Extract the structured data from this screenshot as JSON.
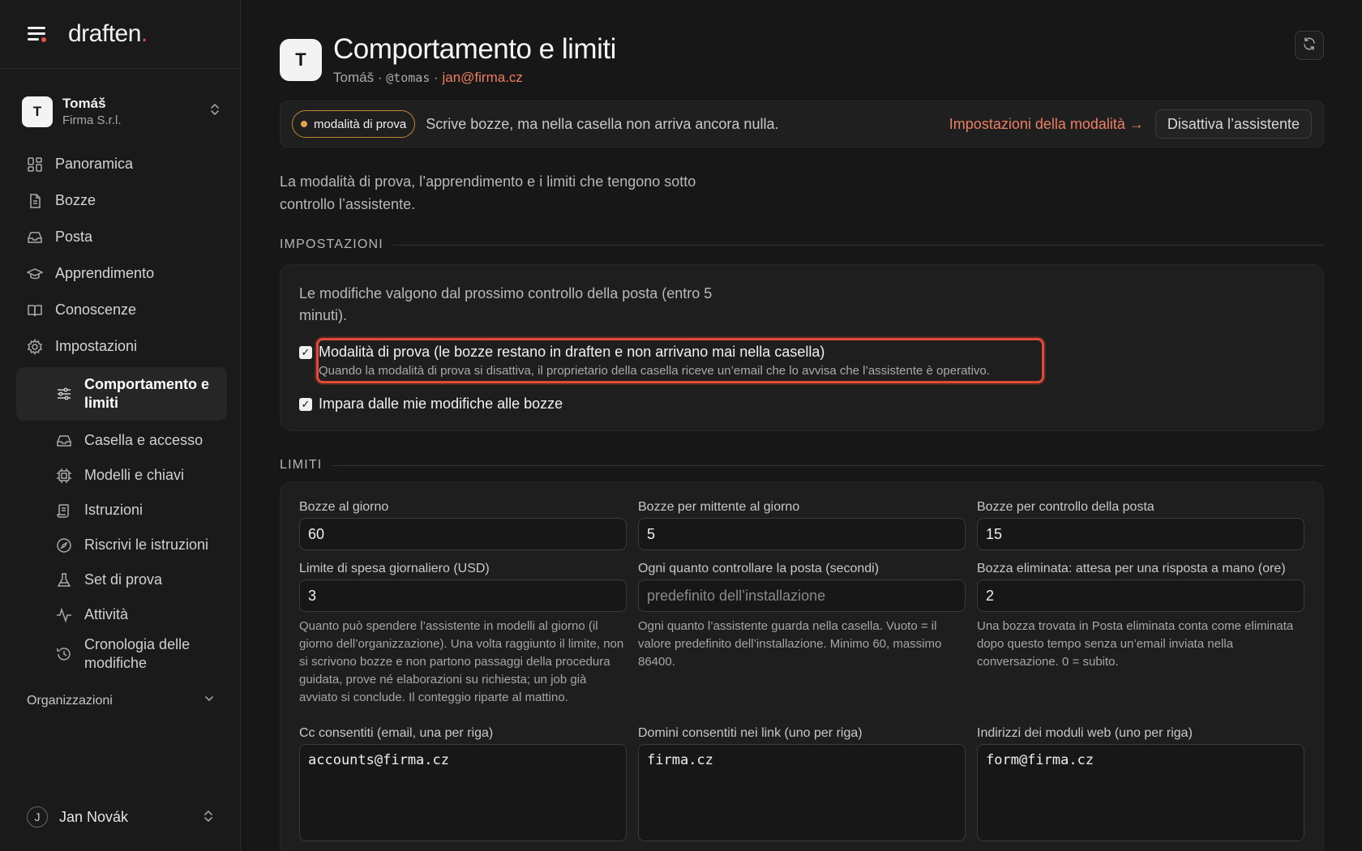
{
  "app": {
    "logo_text": "draften",
    "logo_dot": "."
  },
  "account": {
    "initial": "T",
    "name": "Tomáš",
    "org": "Firma S.r.l."
  },
  "nav": {
    "items": [
      {
        "label": "Panoramica",
        "icon": "grid-icon"
      },
      {
        "label": "Bozze",
        "icon": "document-icon"
      },
      {
        "label": "Posta",
        "icon": "inbox-icon"
      },
      {
        "label": "Apprendimento",
        "icon": "graduation-cap-icon"
      },
      {
        "label": "Conoscenze",
        "icon": "book-icon"
      },
      {
        "label": "Impostazioni",
        "icon": "gear-icon"
      }
    ],
    "sub_items": [
      {
        "label": "Comportamento e limiti",
        "icon": "sliders-icon",
        "active": true
      },
      {
        "label": "Casella e accesso",
        "icon": "inbox-icon"
      },
      {
        "label": "Modelli e chiavi",
        "icon": "chip-icon"
      },
      {
        "label": "Istruzioni",
        "icon": "script-icon"
      },
      {
        "label": "Riscrivi le istruzioni",
        "icon": "compass-icon"
      },
      {
        "label": "Set di prova",
        "icon": "flask-icon"
      },
      {
        "label": "Attività",
        "icon": "activity-icon"
      },
      {
        "label": "Cronologia delle modifiche",
        "icon": "history-icon"
      }
    ],
    "orgs_label": "Organizzazioni"
  },
  "user": {
    "initial": "J",
    "name": "Jan Novák"
  },
  "header": {
    "initial": "T",
    "title": "Comportamento e limiti",
    "name": "Tomáš",
    "sep1": " · ",
    "handle": "@tomas",
    "sep2": " · ",
    "email": "jan@firma.cz"
  },
  "banner": {
    "pill": "modalità di prova",
    "text": "Scrive bozze, ma nella casella non arriva ancora nulla.",
    "link": "Impostazioni della modalità →",
    "button": "Disattiva l’assistente"
  },
  "intro": "La modalità di prova, l’apprendimento e i limiti che tengono sotto controllo l’assistente.",
  "settings": {
    "heading": "IMPOSTAZIONI",
    "note": "Le modifiche valgono dal prossimo controllo della posta (entro 5 minuti).",
    "test_mode": {
      "checked": true,
      "label": "Modalità di prova (le bozze restano in draften e non arrivano mai nella casella)",
      "desc": "Quando la modalità di prova si disattiva, il proprietario della casella riceve un’email che lo avvisa che l’assistente è operativo."
    },
    "learn": {
      "checked": true,
      "label": "Impara dalle mie modifiche alle bozze"
    }
  },
  "limits": {
    "heading": "LIMITI",
    "drafts_per_day": {
      "label": "Bozze al giorno",
      "value": "60"
    },
    "drafts_per_sender": {
      "label": "Bozze per mittente al giorno",
      "value": "5"
    },
    "drafts_per_check": {
      "label": "Bozze per controllo della posta",
      "value": "15"
    },
    "spend_limit": {
      "label": "Limite di spesa giornaliero (USD)",
      "value": "3",
      "help": "Quanto può spendere l’assistente in modelli al giorno (il giorno dell’organizzazione). Una volta raggiunto il limite, non si scrivono bozze e non partono passaggi della procedura guidata, prove né elaborazioni su richiesta; un job già avviato si conclude. Il conteggio riparte al mattino."
    },
    "check_interval": {
      "label": "Ogni quanto controllare la posta (secondi)",
      "placeholder": "predefinito dell’installazione",
      "help": "Ogni quanto l’assistente guarda nella casella. Vuoto = il valore predefinito dell’installazione. Minimo 60, massimo 86400."
    },
    "deleted_wait": {
      "label": "Bozza eliminata: attesa per una risposta a mano (ore)",
      "value": "2",
      "help": "Una bozza trovata in Posta eliminata conta come eliminata dopo questo tempo senza un’email inviata nella conversazione. 0 = subito."
    },
    "cc_allowed": {
      "label": "Cc consentiti (email, una per riga)",
      "value": "accounts@firma.cz"
    },
    "link_domains": {
      "label": "Domini consentiti nei link (uno per riga)",
      "value": "firma.cz"
    },
    "form_addresses": {
      "label": "Indirizzi dei moduli web (uno per riga)",
      "value": "form@firma.cz"
    }
  },
  "colors": {
    "background": "#171717",
    "accent": "#ee7e63",
    "highlight": "#e04a37",
    "pill_border": "#c0893a"
  }
}
